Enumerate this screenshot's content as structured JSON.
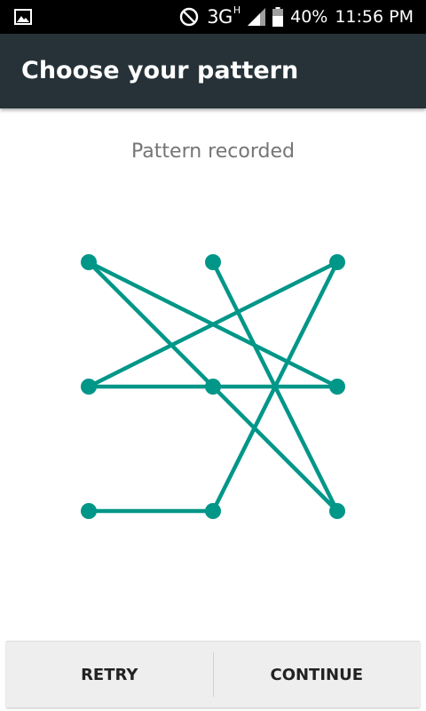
{
  "status_bar": {
    "network_type": "3G",
    "network_sup": "H",
    "battery": "40%",
    "time": "11:56 PM",
    "icons": [
      "image-notification-icon",
      "do-not-disturb-icon",
      "signal-icon",
      "battery-icon"
    ]
  },
  "app_bar": {
    "title": "Choose your pattern"
  },
  "header_message": "Pattern recorded",
  "pattern": {
    "grid_rows": 3,
    "grid_cols": 3,
    "sequence": [
      [
        0,
        1
      ],
      [
        2,
        3
      ],
      [
        1,
        3
      ],
      [
        2,
        3
      ],
      [
        1,
        1
      ],
      [
        1,
        2
      ],
      [
        1,
        3
      ],
      [
        0,
        2
      ],
      [
        0,
        1
      ],
      [
        2,
        2
      ],
      [
        3,
        2
      ],
      [
        3,
        1
      ]
    ],
    "color": "#009688"
  },
  "footer": {
    "retry_label": "RETRY",
    "continue_label": "CONTINUE"
  }
}
